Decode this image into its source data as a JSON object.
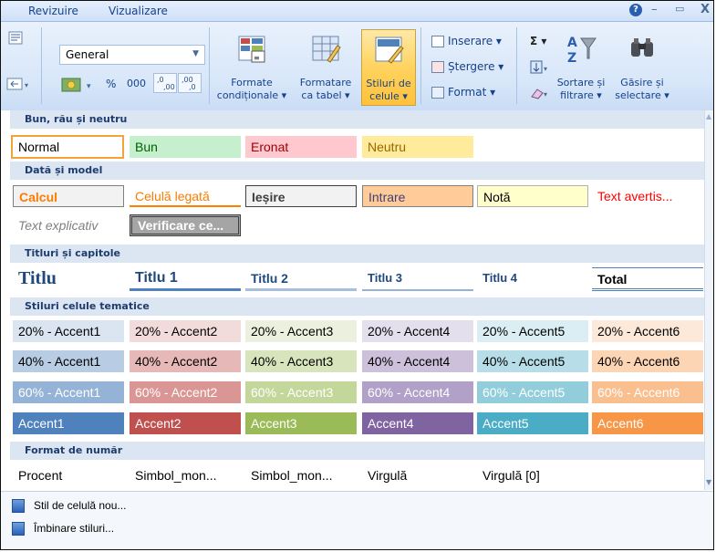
{
  "tabs": {
    "revizuire": "Revizuire",
    "vizualizare": "Vizualizare"
  },
  "window": {
    "help": "?",
    "minimize": "–",
    "restore": "▭",
    "close": "X"
  },
  "ribbon": {
    "number_format_value": "General",
    "percent": "%",
    "thousands": "000",
    "inc_dec": ",0 ,00",
    "dec_dec": ",00 ,0",
    "formatare_conditionala": "Formate condiționale ▾",
    "formatare_tabel": "Formatare ca tabel ▾",
    "stiluri_celule": "Stiluri de celule ▾",
    "inserare": "Inserare ▾",
    "stergere": "Ștergere ▾",
    "format": "Format ▾",
    "sigma": "Σ ▾",
    "sortare": "Sortare și filtrare ▾",
    "gasire": "Găsire și selectare ▾"
  },
  "sections": [
    {
      "title": "Bun, rău și neutru"
    },
    {
      "title": "Dată și model"
    },
    {
      "title": "Titluri și capitole"
    },
    {
      "title": "Stiluri celule tematice"
    },
    {
      "title": "Format de număr"
    }
  ],
  "cells": {
    "normal": "Normal",
    "bun": "Bun",
    "eronat": "Eronat",
    "neutru": "Neutru",
    "calcul": "Calcul",
    "celula_legata": "Celulă legată",
    "iesire": "Ieșire",
    "intrare": "Intrare",
    "nota": "Notă",
    "text_avertis": "Text avertis...",
    "text_explicativ": "Text explicativ",
    "verificare": "Verificare ce...",
    "titlu": "Titlu",
    "titlu1": "Titlu 1",
    "titlu2": "Titlu 2",
    "titlu3": "Titlu 3",
    "titlu4": "Titlu 4",
    "total": "Total",
    "a20": [
      "20% - Accent1",
      "20% - Accent2",
      "20% - Accent3",
      "20% - Accent4",
      "20% - Accent5",
      "20% - Accent6"
    ],
    "a40": [
      "40% - Accent1",
      "40% - Accent2",
      "40% - Accent3",
      "40% - Accent4",
      "40% - Accent5",
      "40% - Accent6"
    ],
    "a60": [
      "60% - Accent1",
      "60% - Accent2",
      "60% - Accent3",
      "60% - Accent4",
      "60% - Accent5",
      "60% - Accent6"
    ],
    "a100": [
      "Accent1",
      "Accent2",
      "Accent3",
      "Accent4",
      "Accent5",
      "Accent6"
    ],
    "procent": "Procent",
    "simbol1": "Simbol_mon...",
    "simbol2": "Simbol_mon...",
    "virgula": "Virgulă",
    "virgula0": "Virgulă [0]"
  },
  "colors": {
    "accent1": "#4f81bd",
    "accent2": "#c0504d",
    "accent3": "#9bbb59",
    "accent4": "#8064a2",
    "accent5": "#4bacc6",
    "accent6": "#f79646"
  },
  "footer": {
    "new_style": "Stil de celulă nou...",
    "merge_styles": "Îmbinare stiluri..."
  }
}
